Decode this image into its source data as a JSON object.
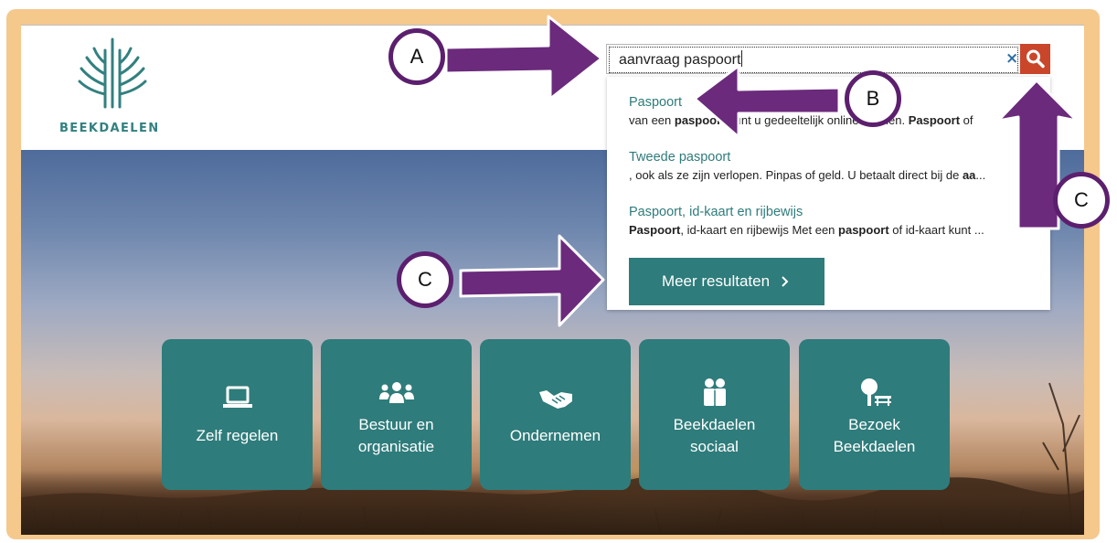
{
  "brand": {
    "name": "BEEKDAELEN",
    "color": "#338080"
  },
  "search": {
    "value": "aanvraag paspoort",
    "clear_icon": "close-icon",
    "button_icon": "search-icon",
    "button_color": "#c9462a"
  },
  "dropdown": {
    "results": [
      {
        "title": "Paspoort",
        "snippet_parts": [
          "van een ",
          "paspoort",
          " kunt u gedeeltelijk online regelen. ",
          "Paspoort",
          " of"
        ]
      },
      {
        "title": "Tweede paspoort",
        "snippet_parts": [
          ", ook als ze zijn verlopen. Pinpas of geld. U betaalt direct bij de ",
          "aa",
          "..."
        ]
      },
      {
        "title": "Paspoort, id-kaart en rijbewijs",
        "snippet_parts": [
          "Paspoort",
          ", id-kaart en rijbewijs Met een ",
          "paspoort",
          " of id-kaart kunt ..."
        ]
      }
    ],
    "more_button": {
      "label": "Meer resultaten",
      "icon": "chevron-right-icon"
    }
  },
  "tiles": [
    {
      "line1": "Zelf regelen",
      "line2": "",
      "icon": "laptop-icon"
    },
    {
      "line1": "Bestuur en",
      "line2": "organisatie",
      "icon": "people-group-icon"
    },
    {
      "line1": "Ondernemen",
      "line2": "",
      "icon": "handshake-icon"
    },
    {
      "line1": "Beekdaelen",
      "line2": "sociaal",
      "icon": "family-icon"
    },
    {
      "line1": "Bezoek",
      "line2": "Beekdaelen",
      "icon": "tree-bench-icon"
    }
  ],
  "tile_color": "#2e7c7b",
  "annotations": {
    "color": "#5c1f6e",
    "labels": {
      "a": "A",
      "b": "B",
      "c_right": "C",
      "c_left": "C"
    }
  }
}
